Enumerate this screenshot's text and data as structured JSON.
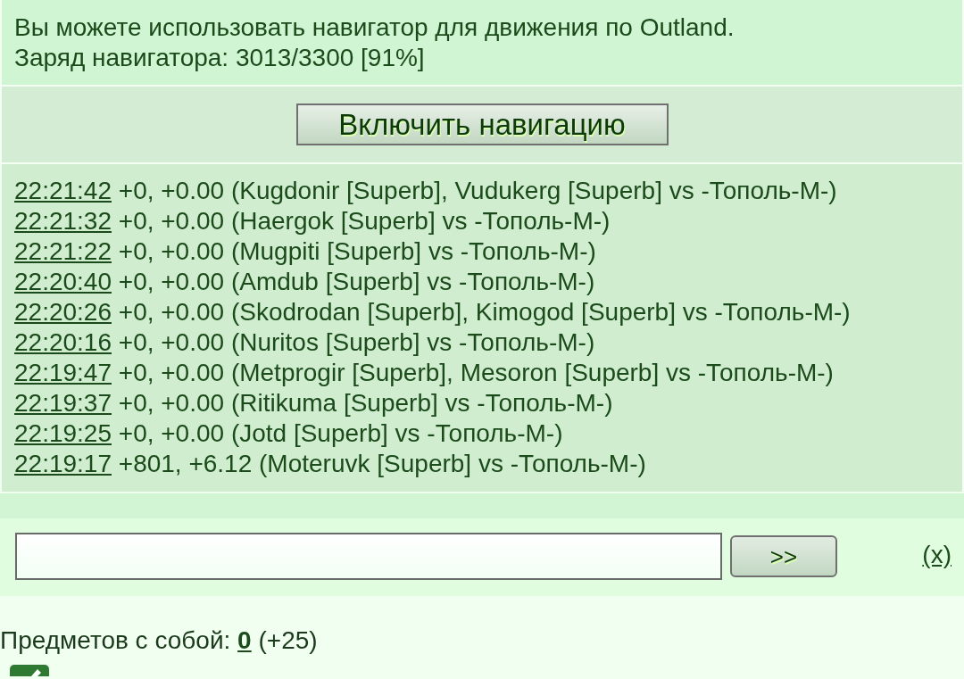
{
  "navigator_info": {
    "lines": [
      "Вы можете использовать навигатор для движения по Outland.",
      "Заряд навигатора: 3013/3300 [91%]"
    ]
  },
  "navigation_button": {
    "label": "Включить навигацию"
  },
  "battle_log": [
    {
      "time": "22:21:42",
      "text": "+0, +0.00 (Kugdonir [Superb], Vudukerg [Superb] vs -Тополь-М-)"
    },
    {
      "time": "22:21:32",
      "text": "+0, +0.00 (Haergok [Superb] vs -Тополь-М-)"
    },
    {
      "time": "22:21:22",
      "text": "+0, +0.00 (Mugpiti [Superb] vs -Тополь-М-)"
    },
    {
      "time": "22:20:40",
      "text": "+0, +0.00 (Amdub [Superb] vs -Тополь-М-)"
    },
    {
      "time": "22:20:26",
      "text": "+0, +0.00 (Skodrodan [Superb], Kimogod [Superb] vs -Тополь-М-)"
    },
    {
      "time": "22:20:16",
      "text": "+0, +0.00 (Nuritos [Superb] vs -Тополь-М-)"
    },
    {
      "time": "22:19:47",
      "text": "+0, +0.00 (Metprogir [Superb], Mesoron [Superb] vs -Тополь-М-)"
    },
    {
      "time": "22:19:37",
      "text": "+0, +0.00 (Ritikuma [Superb] vs -Тополь-М-)"
    },
    {
      "time": "22:19:25",
      "text": "+0, +0.00 (Jotd [Superb] vs -Тополь-М-)"
    },
    {
      "time": "22:19:17",
      "text": "+801, +6.12 (Moteruvk [Superb] vs -Тополь-М-)"
    }
  ],
  "command_bar": {
    "send_button": {
      "label": ">>"
    },
    "clear_link": {
      "label": "(x)"
    }
  },
  "inventory": {
    "label": "Предметов с собой:",
    "count": "0",
    "extra": "(+25)"
  }
}
